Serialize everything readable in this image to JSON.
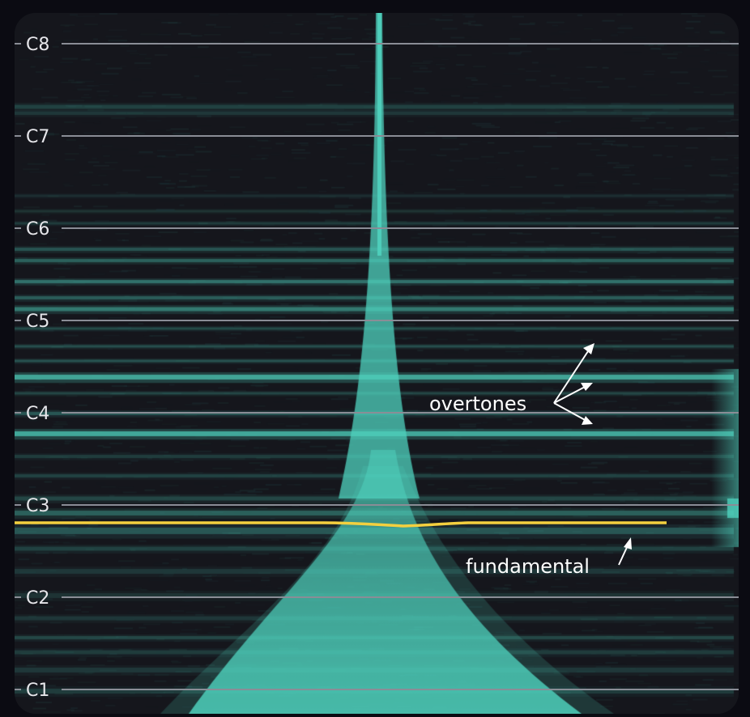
{
  "chart_data": {
    "type": "heatmap",
    "y_scale": "log2-pitch",
    "y_ticks": [
      "C1",
      "C2",
      "C3",
      "C4",
      "C5",
      "C6",
      "C7",
      "C8"
    ],
    "grid": true,
    "colors": {
      "background": "#15161c",
      "spectral": "#4fd1bd",
      "fundamental_line": "#f4d03f",
      "grid": "#8a8d96",
      "annotation": "#ffffff"
    },
    "annotations": {
      "overtones": "overtones",
      "fundamental": "fundamental"
    }
  }
}
